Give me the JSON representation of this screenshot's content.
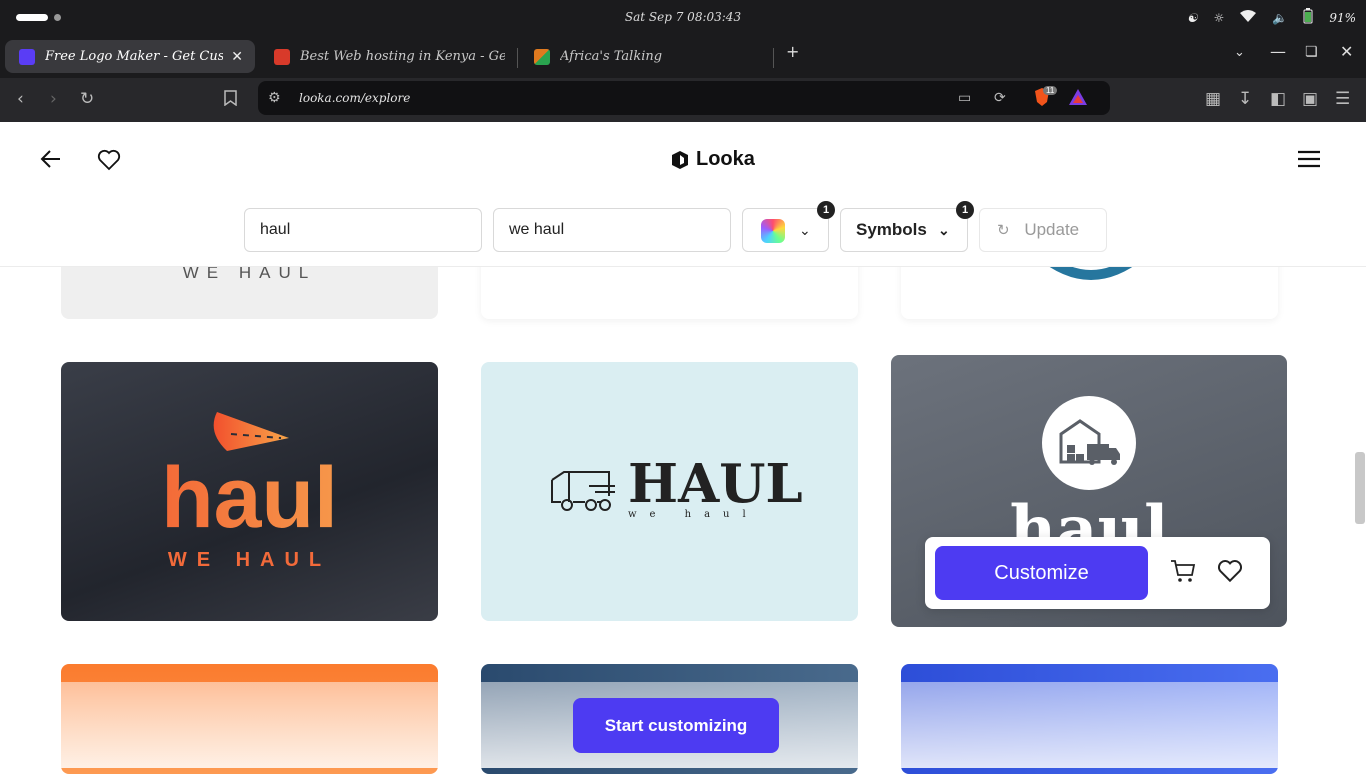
{
  "system": {
    "clock": "Sat Sep 7   08:03:43",
    "battery": "91%"
  },
  "tabs": [
    {
      "label": "Free Logo Maker - Get Custom",
      "favicon_color": "#5a3df5"
    },
    {
      "label": "Best Web hosting in Kenya - Get yo",
      "favicon_color": "#d83a2a"
    },
    {
      "label": "Africa's Talking",
      "favicon_color": "#e07a1f"
    }
  ],
  "toolbar": {
    "url": "looka.com/explore",
    "brave_badge": "11"
  },
  "header": {
    "brand": "Looka"
  },
  "filters": {
    "name": "haul",
    "slogan": "we haul",
    "color_badge": "1",
    "symbols_label": "Symbols",
    "symbols_badge": "1",
    "update_label": "Update"
  },
  "cards": {
    "top1_slogan": "WE HAUL",
    "c1_name": "haul",
    "c1_slogan": "WE HAUL",
    "c2_name": "HAUL",
    "c2_slogan": "we haul",
    "c3_name": "haul"
  },
  "hover": {
    "customize_label": "Customize"
  },
  "cta": {
    "start_label": "Start customizing"
  },
  "colors": {
    "accent": "#4d3bf2",
    "card1_bg": "#2a2d36",
    "card2_bg": "#daeef2",
    "card3_bg": "#5b616b"
  }
}
